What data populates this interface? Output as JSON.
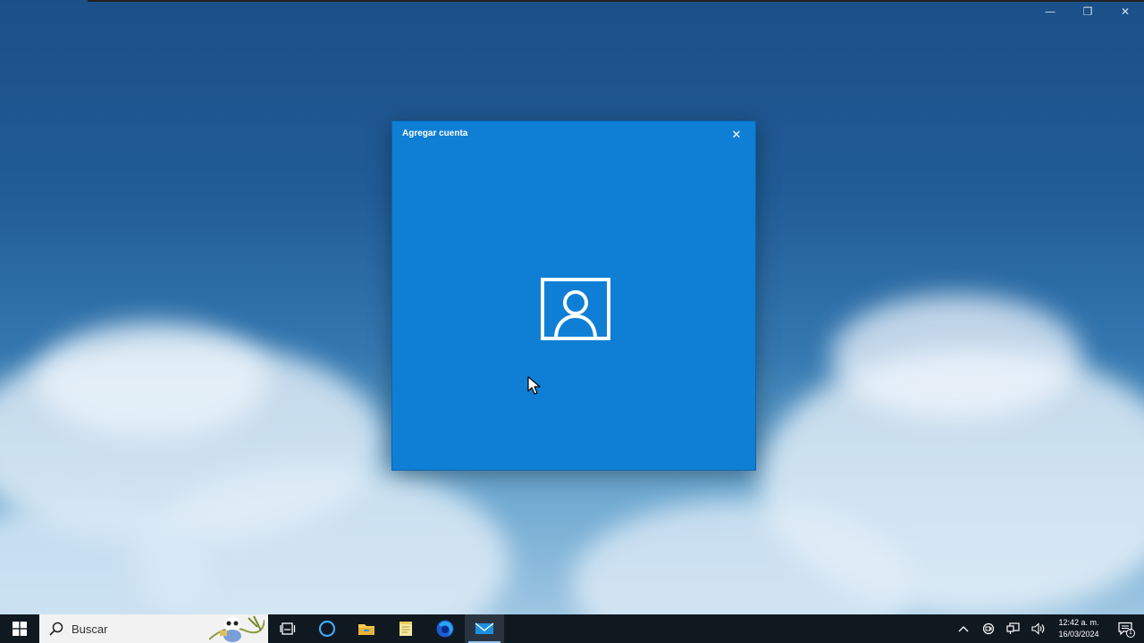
{
  "window": {
    "controls": {
      "minimize": "—",
      "restore": "❐",
      "close": "✕"
    }
  },
  "dialog": {
    "title": "Agregar cuenta",
    "close_glyph": "✕",
    "icon": "person-icon",
    "background": "#0f7fd6"
  },
  "taskbar": {
    "search_placeholder": "Buscar",
    "apps": [
      {
        "name": "task-view-icon"
      },
      {
        "name": "cortana-icon"
      },
      {
        "name": "file-explorer-icon"
      },
      {
        "name": "notes-icon"
      },
      {
        "name": "firefox-icon"
      },
      {
        "name": "mail-icon",
        "active": true
      }
    ],
    "clock": {
      "time": "12:42 a. m.",
      "date": "16/03/2024"
    },
    "notification_count": "1"
  },
  "colors": {
    "accent": "#0f7fd6",
    "taskbar": "#101820"
  }
}
